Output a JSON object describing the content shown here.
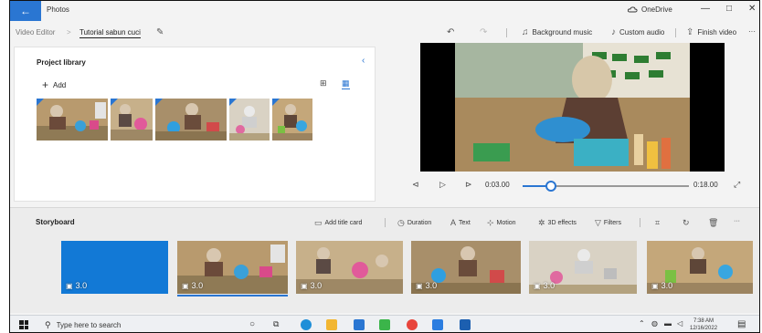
{
  "window": {
    "app_title": "Photos",
    "onedrive_label": "OneDrive",
    "controls": {
      "minimize": "—",
      "maximize": "□",
      "close": "✕"
    }
  },
  "toolbar": {
    "breadcrumb_root": "Video Editor",
    "breadcrumb_sep": ">",
    "project_name": "Tutorial sabun cuci",
    "background_music": "Background music",
    "custom_audio": "Custom audio",
    "finish_video": "Finish video",
    "more": "···"
  },
  "library": {
    "title": "Project library",
    "add_label": "Add"
  },
  "playback": {
    "current_time": "0:03.00",
    "total_time": "0:18.00",
    "progress": 0.17
  },
  "storyboard": {
    "title": "Storyboard",
    "tools": {
      "add_title_card": "Add title card",
      "duration": "Duration",
      "text": "Text",
      "motion": "Motion",
      "effects_3d": "3D effects",
      "filters": "Filters",
      "more": "···"
    },
    "clips": [
      {
        "duration": "3.0",
        "kind": "title-card",
        "color": "#1279d6"
      },
      {
        "duration": "3.0",
        "kind": "video"
      },
      {
        "duration": "3.0",
        "kind": "video"
      },
      {
        "duration": "3.0",
        "kind": "video"
      },
      {
        "duration": "3.0",
        "kind": "video"
      },
      {
        "duration": "3.0",
        "kind": "video"
      }
    ],
    "selected_clip": 1
  },
  "taskbar": {
    "search_placeholder": "Type here to search",
    "time": "7:38 AM",
    "date": "12/16/2022"
  },
  "colors": {
    "accent": "#2a76d2",
    "title_card": "#1279d6"
  }
}
